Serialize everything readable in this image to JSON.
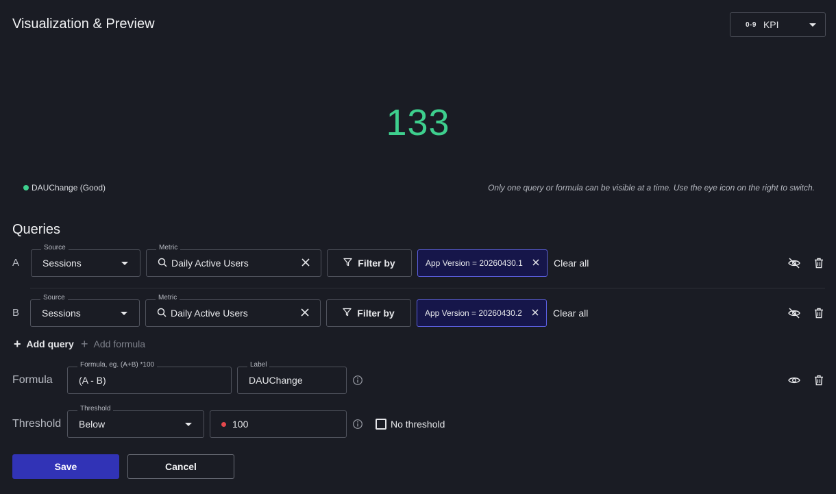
{
  "header": {
    "title": "Visualization & Preview",
    "viz_type": {
      "icon_text": "0-9",
      "label": "KPI"
    }
  },
  "preview": {
    "kpi_value": "133",
    "legend": {
      "label": "DAUChange (Good)",
      "color": "#3ecf8e"
    },
    "hint": "Only one query or formula can be visible at a time. Use the eye icon on the right to switch."
  },
  "queries": {
    "title": "Queries",
    "rows": [
      {
        "letter": "A",
        "source_label": "Source",
        "source": "Sessions",
        "metric_label": "Metric",
        "metric": "Daily Active Users",
        "filter_label": "Filter by",
        "chip": "App Version = 20260430.1",
        "clear_all": "Clear all",
        "visible": false
      },
      {
        "letter": "B",
        "source_label": "Source",
        "source": "Sessions",
        "metric_label": "Metric",
        "metric": "Daily Active Users",
        "filter_label": "Filter by",
        "chip": "App Version = 20260430.2",
        "clear_all": "Clear all",
        "visible": false
      }
    ],
    "add_query": "Add query",
    "add_formula": "Add formula"
  },
  "formula": {
    "row_label": "Formula",
    "formula_label": "Formula, eg. (A+B) *100",
    "formula_value": "(A - B)",
    "label_label": "Label",
    "label_value": "DAUChange",
    "visible": true
  },
  "threshold": {
    "row_label": "Threshold",
    "select_label": "Threshold",
    "select_value": "Below",
    "value": "100",
    "no_threshold_label": "No threshold",
    "no_threshold_checked": false
  },
  "actions": {
    "save": "Save",
    "cancel": "Cancel"
  },
  "colors": {
    "accent": "#3133b6",
    "kpi_good": "#3ecf8e",
    "chip_border": "#5b5fe0",
    "threshold_dot": "#e5484d"
  }
}
